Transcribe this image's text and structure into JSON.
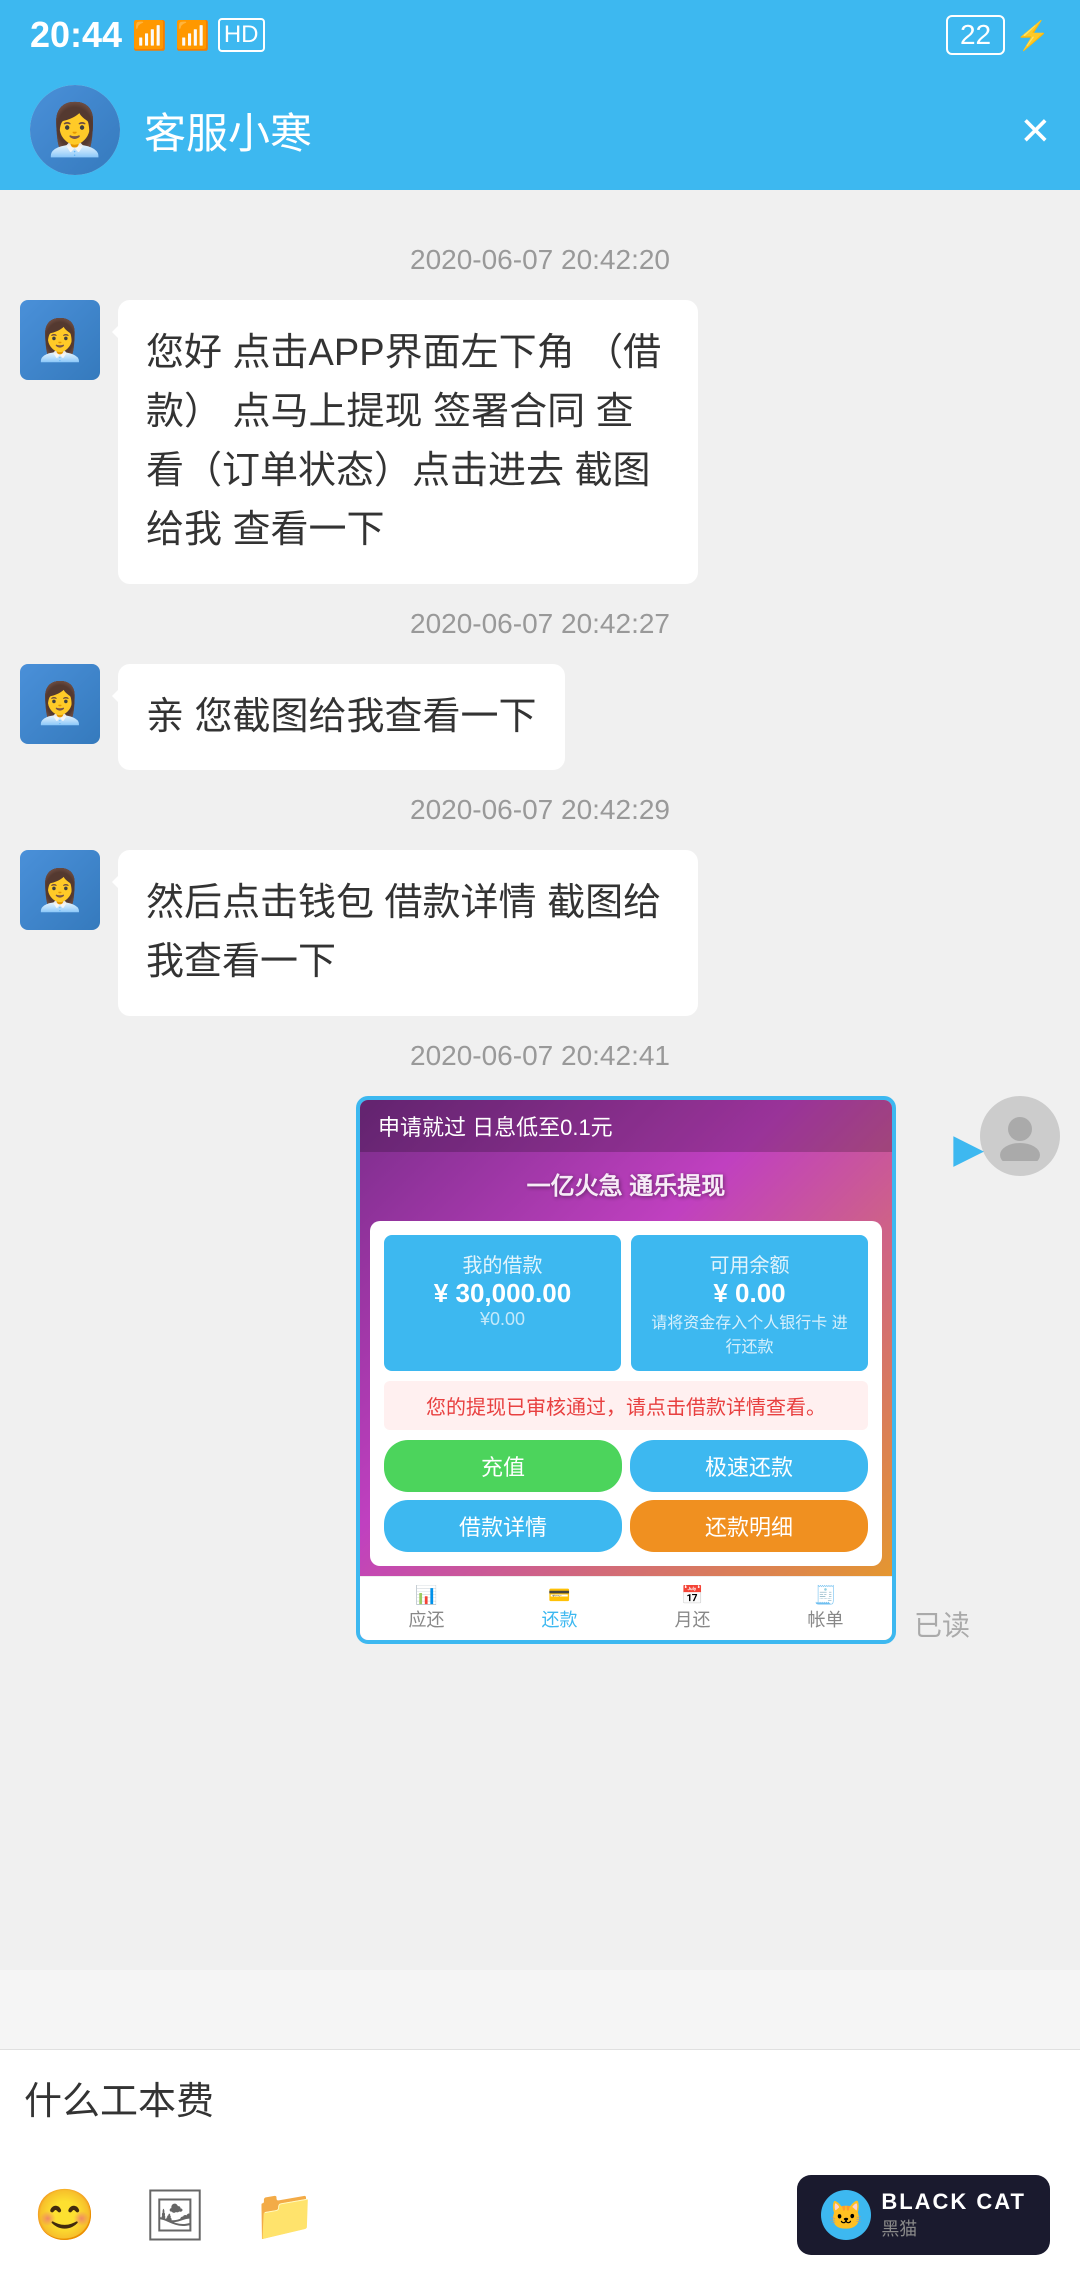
{
  "statusBar": {
    "time": "20:44",
    "battery": "22",
    "hd": "HD"
  },
  "header": {
    "name": "客服小寒",
    "closeLabel": "×"
  },
  "messages": [
    {
      "id": 1,
      "type": "timestamp",
      "text": "2020-06-07 20:42:20"
    },
    {
      "id": 2,
      "type": "agent",
      "text": "您好 点击APP界面左下角 （借款） 点马上提现 签署合同 查看（订单状态）点击进去  截图给我 查看一下"
    },
    {
      "id": 3,
      "type": "timestamp",
      "text": "2020-06-07 20:42:27"
    },
    {
      "id": 4,
      "type": "agent",
      "text": "亲 您截图给我查看一下"
    },
    {
      "id": 5,
      "type": "timestamp",
      "text": "2020-06-07 20:42:29"
    },
    {
      "id": 6,
      "type": "agent",
      "text": "然后点击钱包 借款详情 截图给我查看一下"
    },
    {
      "id": 7,
      "type": "timestamp",
      "text": "2020-06-07 20:42:41"
    },
    {
      "id": 8,
      "type": "user_image",
      "readLabel": "已读",
      "imageData": {
        "headerText": "申请就过 日息低至0.1元",
        "subHeader": "一亿火急 通乐提现",
        "myLoan": "¥ 30,000.00",
        "myLoanLabel": "我的借款",
        "available": "¥ 0.00",
        "availableLabel": "可用余额",
        "noticeText": "您的提现已审核通过，请点击借款详情查看。",
        "btn1": "充值",
        "btn2": "极速还款",
        "btn3": "借款详情",
        "btn4": "还款明细",
        "nav1": "应还",
        "nav2": "还款",
        "nav3": "月还",
        "nav4": "帐单"
      }
    }
  ],
  "inputArea": {
    "currentText": "什么工本费",
    "placeholder": ""
  },
  "toolbar": {
    "emojiLabel": "😊",
    "imageLabel": "🖼",
    "fileLabel": "📁"
  },
  "blackCat": {
    "text": "BLACK CAT",
    "subText": "黑猫"
  }
}
